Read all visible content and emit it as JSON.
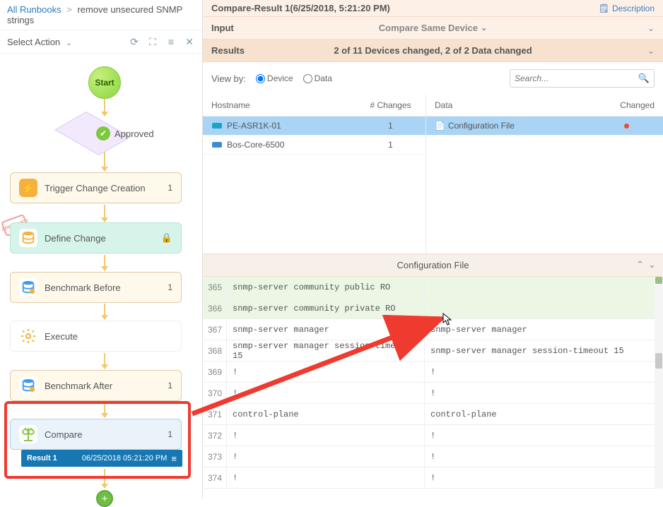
{
  "breadcrumb": {
    "root": "All Runbooks",
    "current": "remove unsecured SNMP strings"
  },
  "toolbar": {
    "selectAction": "Select Action"
  },
  "flow": {
    "start": "Start",
    "approved": "Approved",
    "approvedStamp": "APPROVED",
    "trigger": {
      "label": "Trigger Change Creation",
      "count": "1"
    },
    "define": {
      "label": "Define Change"
    },
    "benchBefore": {
      "label": "Benchmark Before",
      "count": "1"
    },
    "execute": {
      "label": "Execute"
    },
    "benchAfter": {
      "label": "Benchmark After",
      "count": "1"
    },
    "compare": {
      "label": "Compare",
      "count": "1"
    },
    "result": {
      "name": "Result 1",
      "date": "06/25/2018 05:21:20 PM"
    }
  },
  "right": {
    "title": "Compare-Result 1(6/25/2018, 5:21:20 PM)",
    "description": "Description",
    "input": {
      "label": "Input",
      "mode": "Compare Same Device"
    },
    "results": {
      "label": "Results",
      "summary": "2 of 11 Devices changed,  2 of 2 Data changed"
    },
    "viewby": {
      "label": "View by:",
      "device": "Device",
      "data": "Data"
    },
    "search": {
      "placeholder": "Search..."
    },
    "headers": {
      "hostname": "Hostname",
      "changes": "# Changes",
      "data": "Data",
      "changed": "Changed"
    },
    "devices": [
      {
        "name": "PE-ASR1K-01",
        "changes": "1",
        "color": "#16a4c9",
        "selected": true
      },
      {
        "name": "Bos-Core-6500",
        "changes": "1",
        "color": "#3d8bd4",
        "selected": false
      }
    ],
    "dataItems": [
      {
        "label": "Configuration File",
        "changed": true
      }
    ],
    "cfgHeader": "Configuration File",
    "diff": [
      {
        "ln": "365",
        "left": "snmp-server community public RO",
        "right": "",
        "removed": true
      },
      {
        "ln": "366",
        "left": "snmp-server community private RO",
        "right": "",
        "removed": true
      },
      {
        "ln": "367",
        "left": "snmp-server manager",
        "right": "snmp-server manager",
        "removed": false
      },
      {
        "ln": "368",
        "left": "snmp-server manager session-timeout 15",
        "right": "snmp-server manager session-timeout 15",
        "removed": false
      },
      {
        "ln": "369",
        "left": "!",
        "right": "!",
        "removed": false
      },
      {
        "ln": "370",
        "left": "!",
        "right": "!",
        "removed": false
      },
      {
        "ln": "371",
        "left": "control-plane",
        "right": "control-plane",
        "removed": false
      },
      {
        "ln": "372",
        "left": "!",
        "right": "!",
        "removed": false
      },
      {
        "ln": "373",
        "left": "!",
        "right": "!",
        "removed": false
      },
      {
        "ln": "374",
        "left": "!",
        "right": "!",
        "removed": false
      }
    ]
  }
}
